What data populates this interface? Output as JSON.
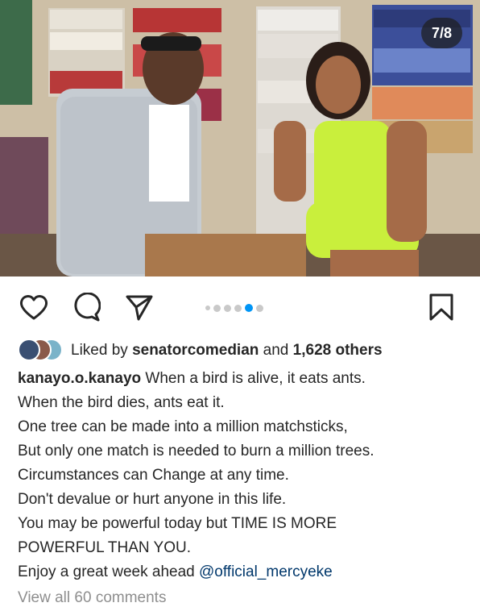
{
  "post": {
    "carousel_counter": "7/8",
    "carousel": {
      "total": 6,
      "active_index": 4
    }
  },
  "likes": {
    "prefix": "Liked by",
    "user": "senatorcomedian",
    "joiner": "and",
    "count": "1,628 others"
  },
  "caption": {
    "username": "kanayo.o.kanayo",
    "text": " When a bird is alive,  it eats ants.\nWhen the bird dies, ants eat it.\nOne tree can be made into a million matchsticks,\nBut only one match is needed to burn a million trees.\nCircumstances can Change at any time.\nDon't devalue or hurt anyone in this life.\nYou may be powerful today but TIME IS MORE\nPOWERFUL THAN YOU.\nEnjoy a great week ahead ",
    "mention": "@official_mercyeke"
  },
  "comments": {
    "link": "View all 60 comments"
  },
  "icons": {
    "like": "heart-icon",
    "comment": "comment-icon",
    "share": "send-icon",
    "save": "bookmark-icon"
  },
  "colors": {
    "active_dot": "#0095f6",
    "mention": "#00376b"
  }
}
